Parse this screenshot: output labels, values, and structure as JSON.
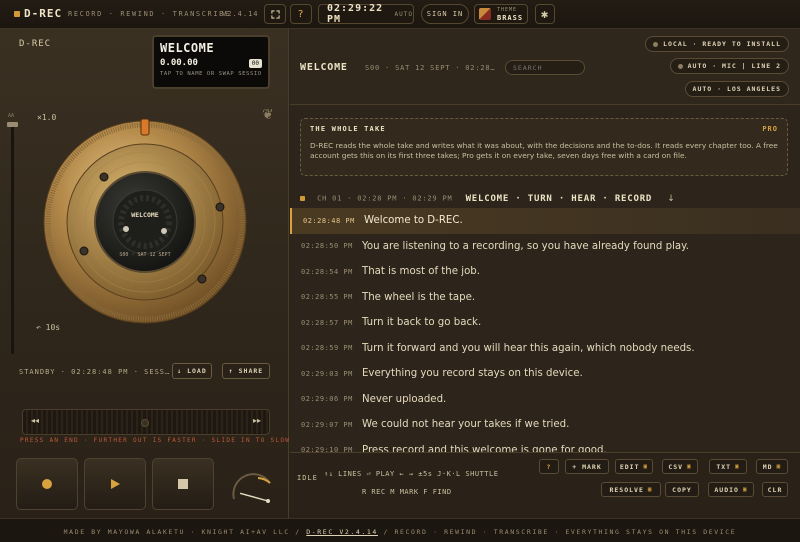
{
  "topbar": {
    "brand": "D-REC",
    "nav": "RECORD · REWIND · TRANSCRIBE",
    "version": "V2.4.14",
    "expand_icon": "expand-icon",
    "help_label": "?",
    "clock": "02:29:22 PM",
    "clock_mode": "AUTO",
    "signin_label": "SIGN IN",
    "theme_label": "THEME",
    "theme_value": "BRASS",
    "gear_icon": "gear-icon"
  },
  "left": {
    "label": "D-REC",
    "lcd": {
      "title": "WELCOME",
      "time": "0.00.00",
      "badge": "00",
      "hint": "TAP TO NAME OR SWAP SESSION"
    },
    "speed": "×1.0",
    "slider_top_label": "AA",
    "rewind_label": "↶ 10s",
    "wheel": {
      "label": "WELCOME",
      "sublabel": "S00 · SAT 12 SEPT"
    },
    "standby": "STANDBY · 02:28:48 PM · SESS…",
    "load_label": "↓ LOAD",
    "share_label": "↑ SHARE",
    "jog_left": "◂◂",
    "jog_right": "▸▸",
    "jog_hint": "PRESS AN END · FURTHER OUT IS FASTER · SLIDE IN TO SLOW",
    "meter_fraction": 0.2
  },
  "right": {
    "title": "WELCOME",
    "meta": "S00 · SAT 12 SEPT · 02:28…",
    "search_placeholder": "SEARCH",
    "pills": [
      "LOCAL · READY TO INSTALL",
      "AUTO · MIC | LINE 2",
      "AUTO · LOS ANGELES"
    ],
    "summary": {
      "heading": "THE WHOLE TAKE",
      "pro": "PRO",
      "body": "D-REC reads the whole take and writes what it was about, with the decisions and the to-dos. It reads every chapter too. A free account gets this on its first three takes; Pro gets it on every take, seven days free with a card on file."
    },
    "chapter": {
      "label": "CH 01 · 02:28 PM · 02:29 PM",
      "name": "WELCOME · TURN · HEAR · RECORD",
      "arrow": "↓"
    },
    "lines": [
      {
        "ts": "02:28:48 PM",
        "text": "Welcome to D-REC."
      },
      {
        "ts": "02:28:50 PM",
        "text": "You are listening to a recording, so you have already found play."
      },
      {
        "ts": "02:28:54 PM",
        "text": "That is most of the job."
      },
      {
        "ts": "02:28:55 PM",
        "text": "The wheel is the tape."
      },
      {
        "ts": "02:28:57 PM",
        "text": "Turn it back to go back."
      },
      {
        "ts": "02:28:59 PM",
        "text": "Turn it forward and you will hear this again, which nobody needs."
      },
      {
        "ts": "02:29:03 PM",
        "text": "Everything you record stays on this device."
      },
      {
        "ts": "02:29:06 PM",
        "text": "Never uploaded."
      },
      {
        "ts": "02:29:07 PM",
        "text": "We could not hear your takes if we tried."
      },
      {
        "ts": "02:29:10 PM",
        "text": "Press record and this welcome is gone for good."
      }
    ],
    "footer": {
      "idle": "IDLE",
      "hk1": "↑↓ LINES  ⏎ PLAY  ← → ±5s  J·K·L SHUTTLE",
      "hk2": "",
      "hk3": "R REC  M MARK  F FIND",
      "help": "?",
      "mark": "+ MARK",
      "edit": "EDIT",
      "csv": "CSV",
      "txt": "TXT",
      "md": "MD",
      "resolve": "RESOLVE",
      "copy": "COPY",
      "audio": "AUDIO",
      "clr": "CLR",
      "lock": "🔒"
    }
  },
  "footer": {
    "left": "MADE BY MAYOWA ALAKETU · KNIGHT AI+AV LLC  /",
    "version": "D-REC V2.4.14",
    "right": "/  RECORD · REWIND · TRANSCRIBE · EVERYTHING STAYS ON THIS DEVICE"
  }
}
